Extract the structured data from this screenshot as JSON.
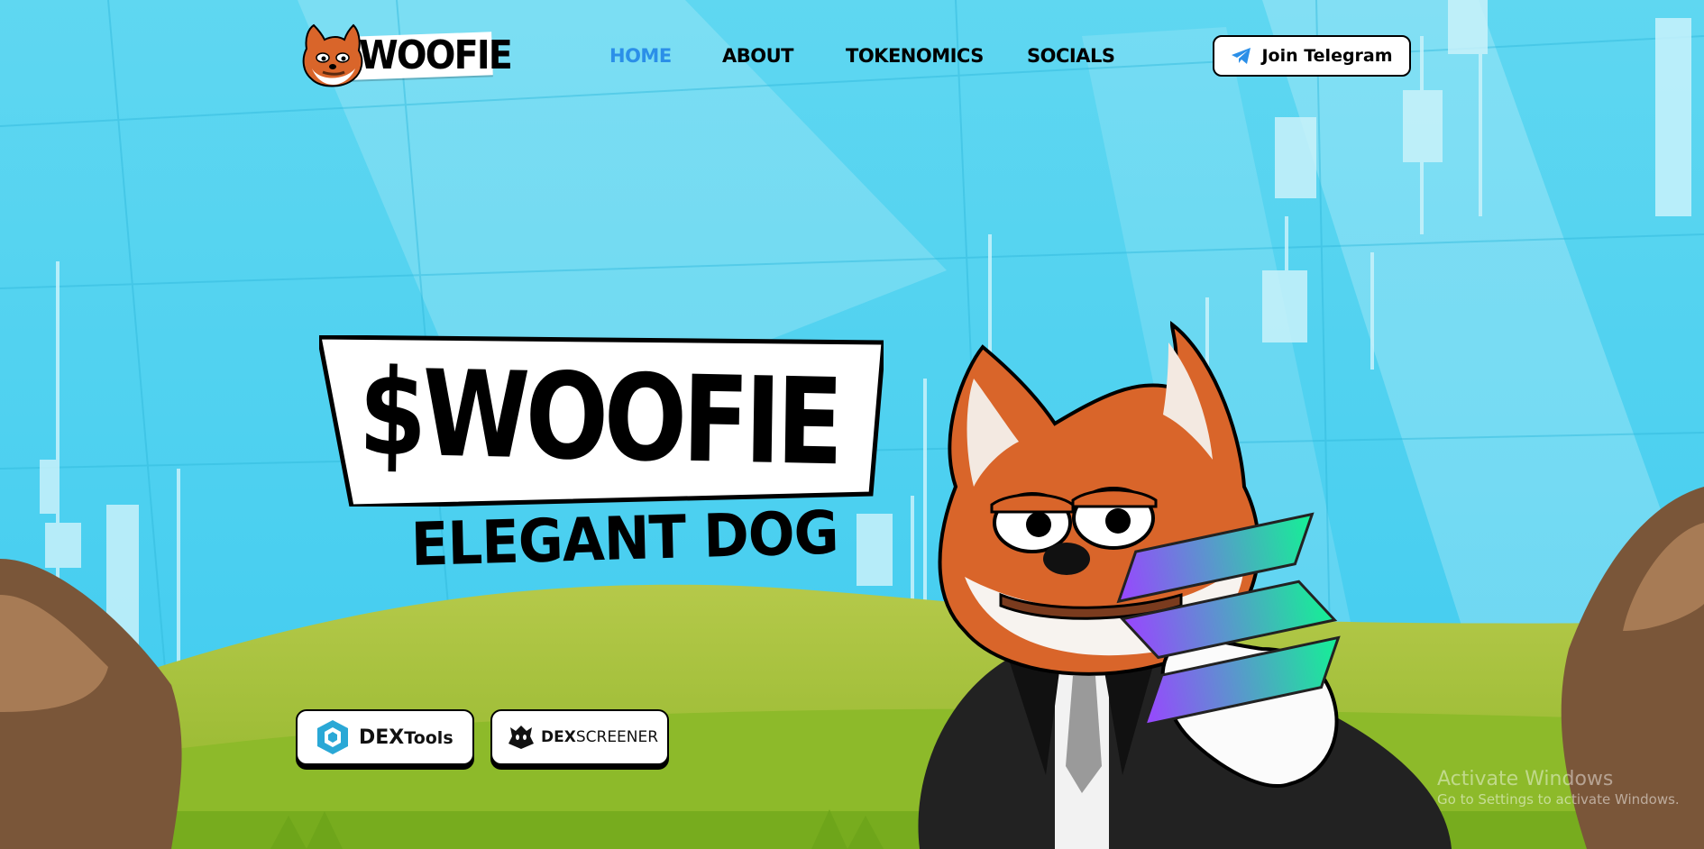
{
  "brand": {
    "logo_text": "WOOFIE",
    "colors": {
      "sky": "#47cfee",
      "accent": "#2b8fe8",
      "grass": "#8cbc2a",
      "fox_orange": "#d9652a",
      "black": "#000000"
    }
  },
  "nav": {
    "items": [
      {
        "label": "HOME",
        "active": true
      },
      {
        "label": "ABOUT",
        "active": false
      },
      {
        "label": "TOKENOMICS",
        "active": false
      },
      {
        "label": "SOCIALS",
        "active": false
      }
    ],
    "telegram_button": {
      "label": "Join Telegram",
      "icon": "telegram-icon"
    }
  },
  "hero": {
    "title": "$WOOFIE",
    "subtitle": "ELEGANT DOG",
    "buttons": [
      {
        "label_bold": "DEX",
        "label_rest": "Tools",
        "icon": "dextools-icon"
      },
      {
        "label_bold": "DEX",
        "label_rest": "SCREENER",
        "icon": "dexscreener-icon"
      }
    ]
  },
  "watermark": {
    "title": "Activate Windows",
    "subtitle": "Go to Settings to activate Windows."
  }
}
